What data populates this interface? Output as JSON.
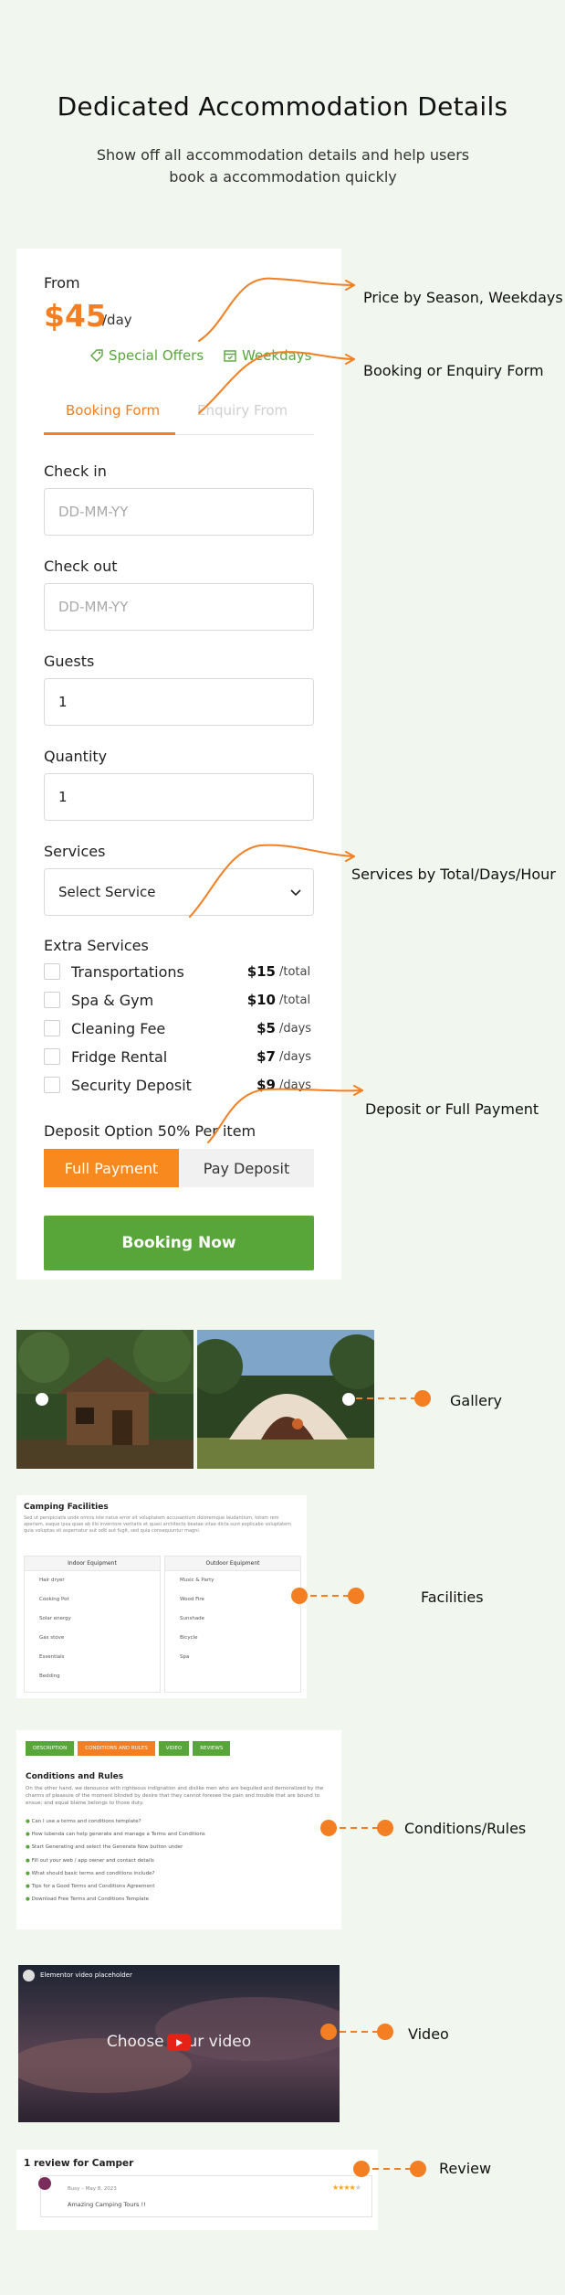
{
  "header": {
    "title": "Dedicated Accommodation Details",
    "subtitle": "Show off all accommodation details and help users book a accommodation quickly"
  },
  "price_block": {
    "from_label": "From",
    "price": "$45",
    "per": "/day",
    "special_offers": "Special Offers",
    "weekdays": "Weekdays"
  },
  "tabs": [
    "Booking Form",
    "Enquiry From"
  ],
  "form": {
    "check_in_label": "Check in",
    "check_in_placeholder": "DD-MM-YY",
    "check_out_label": "Check out",
    "check_out_placeholder": "DD-MM-YY",
    "guests_label": "Guests",
    "guests_value": "1",
    "quantity_label": "Quantity",
    "quantity_value": "1",
    "services_label": "Services",
    "services_value": "Select Service"
  },
  "extra_services": {
    "title": "Extra Services",
    "items": [
      {
        "name": "Transportations",
        "price": "$15",
        "unit": "/total"
      },
      {
        "name": "Spa & Gym",
        "price": "$10",
        "unit": "/total"
      },
      {
        "name": "Cleaning Fee",
        "price": "$5",
        "unit": "/days"
      },
      {
        "name": "Fridge Rental",
        "price": "$7",
        "unit": "/days"
      },
      {
        "name": "Security Deposit",
        "price": "$9",
        "unit": "/days"
      }
    ]
  },
  "deposit": {
    "title": "Deposit Option 50% Per item",
    "full_payment": "Full Payment",
    "pay_deposit": "Pay Deposit"
  },
  "booking_button": "Booking Now",
  "callouts": {
    "price": "Price by Season, Weekdays",
    "form": "Booking or Enquiry Form",
    "services": "Services by Total/Days/Hour",
    "deposit": "Deposit or Full Payment",
    "gallery": "Gallery",
    "facilities": "Facilities",
    "conditions": "Conditions/Rules",
    "video": "Video",
    "review": "Review"
  },
  "facilities": {
    "title": "Camping Facilities",
    "intro": "Sed ut perspiciatis unde omnis iste natus error sit voluptatem accusantium doloremque laudantium, totam rem aperiam, eaque ipsa quae ab illo inventore veritatis et quasi architecto beatae vitae dicta sunt explicabo voluptatem quia voluptas sit aspernatur aut odit aut fugit, sed quia consequuntur magni.",
    "indoor_title": "Indoor Equipment",
    "outdoor_title": "Outdoor Equipment",
    "indoor": [
      "Hair dryer",
      "Cooking Pot",
      "Solar energy",
      "Gas stove",
      "Essentials",
      "Bedding"
    ],
    "outdoor": [
      "Music & Party",
      "Wood Fire",
      "Sunshade",
      "Bicycle",
      "Spa"
    ]
  },
  "conditions": {
    "tabs": [
      "DESCRIPTION",
      "CONDITIONS AND RULES",
      "VIDEO",
      "REVIEWS"
    ],
    "title": "Conditions and Rules",
    "intro": "On the other hand, we denounce with righteous indignation and dislike men who are beguiled and demoralized by the charms of pleasure of the moment blinded by desire that they cannot foresee the pain and trouble that are bound to ensue; and equal blame belongs to those duty.",
    "items": [
      "Can I use a terms and conditions template?",
      "How iubenda can help generate and manage a Terms and Conditions",
      "Start Generating and select the Generate Now button under",
      "Fill out your web / app owner and contact details",
      "What should basic terms and conditions include?",
      "Tips for a Good Terms and Conditions Agreement",
      "Download Free Terms and Conditions Template"
    ]
  },
  "video": {
    "title": "Elementor video placeholder",
    "caption": "Choose your video"
  },
  "review": {
    "title": "1 review for Camper",
    "meta": "Busy – May 8, 2023",
    "text": "Amazing Camping Tours !!",
    "rating": 4
  },
  "colors": {
    "accent": "#f37f22",
    "green": "#58a63a",
    "background": "#f1f6ee"
  }
}
